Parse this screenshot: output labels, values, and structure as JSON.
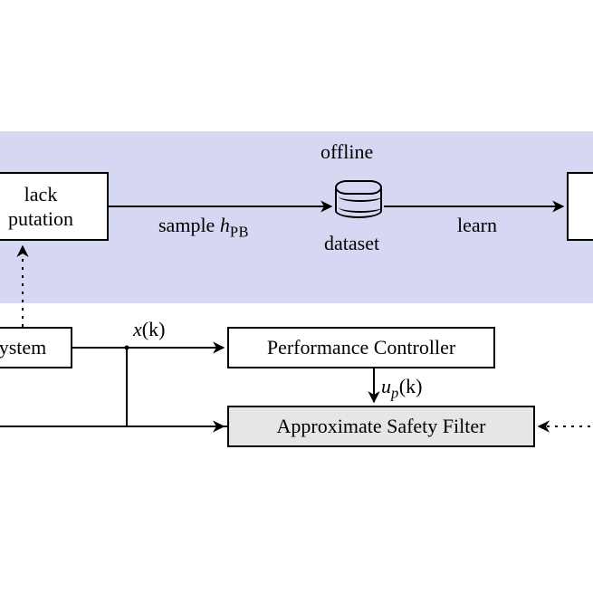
{
  "diagram": {
    "offline_label": "offline",
    "sample_label_pre": "sample ",
    "sample_h": "h",
    "sample_sub": "PB",
    "dataset_label": "dataset",
    "learn_label": "learn",
    "xk_pre": "x",
    "xk_post": "(k)",
    "upk_pre": "u",
    "upk_sub": "p",
    "upk_post": "(k)"
  },
  "boxes": {
    "black_line1": "lack",
    "black_line2": "putation",
    "system": "ystem",
    "perf_controller": "Performance Controller",
    "safety_filter": "Approximate Safety Filter"
  },
  "colors": {
    "band": "#d6d7f2",
    "grey": "#e6e6e6"
  }
}
